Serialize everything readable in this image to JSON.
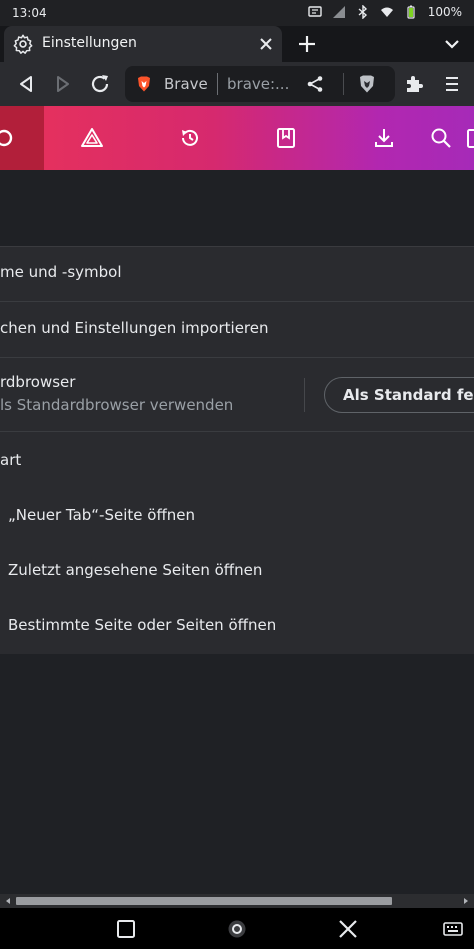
{
  "status": {
    "time": "13:04",
    "battery": "100%"
  },
  "tab": {
    "title": "Einstellungen"
  },
  "omnibox": {
    "brand": "Brave",
    "url": "brave:..."
  },
  "settings": {
    "rows": [
      {
        "label": "me und -symbol"
      },
      {
        "label": "chen und Einstellungen importieren"
      },
      {
        "label": "rdbrowser",
        "sub": "ls Standardbrowser verwenden"
      },
      {
        "label": "art"
      },
      {
        "label": "„Neuer Tab“-Seite öffnen"
      },
      {
        "label": "Zuletzt angesehene Seiten öffnen"
      },
      {
        "label": "Bestimmte Seite oder Seiten öffnen"
      }
    ],
    "default_button": "Als Standard festlegen"
  },
  "colors": {
    "gradient_start": "#e8325a",
    "gradient_end": "#a62ab8",
    "card_bg": "#2a2b2f",
    "page_bg": "#1f2125"
  }
}
